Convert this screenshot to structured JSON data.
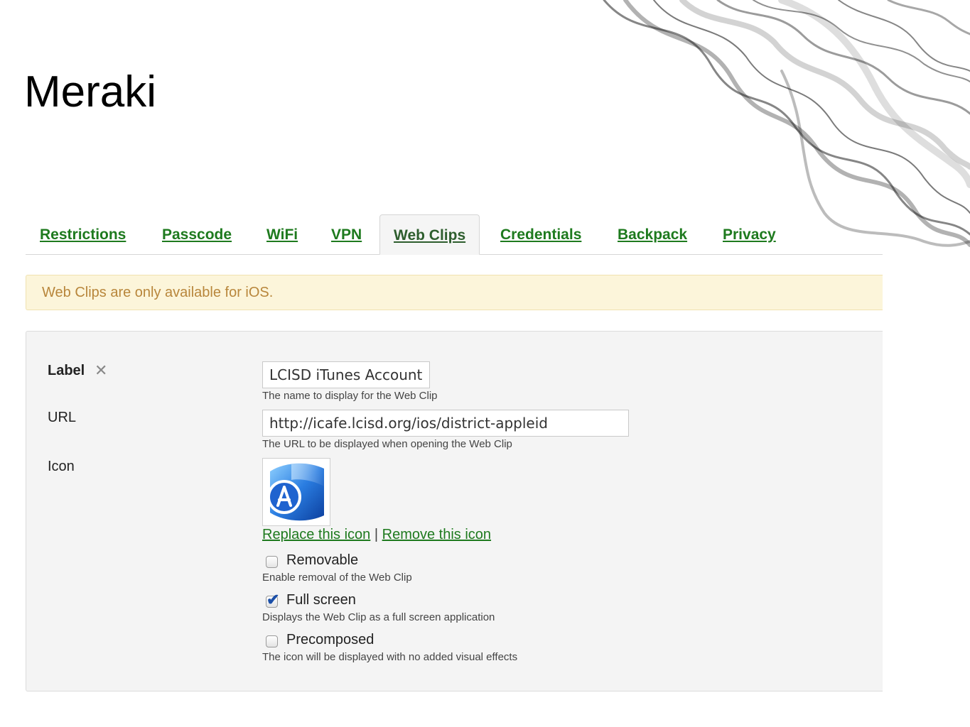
{
  "slide": {
    "title": "Meraki"
  },
  "tabs": [
    {
      "label": "Restrictions",
      "active": false
    },
    {
      "label": "Passcode",
      "active": false
    },
    {
      "label": "WiFi",
      "active": false
    },
    {
      "label": "VPN",
      "active": false
    },
    {
      "label": "Web Clips",
      "active": true
    },
    {
      "label": "Credentials",
      "active": false
    },
    {
      "label": "Backpack",
      "active": false
    },
    {
      "label": "Privacy",
      "active": false
    }
  ],
  "notice": {
    "text": "Web Clips are only available for iOS."
  },
  "form": {
    "label": {
      "title": "Label",
      "clear_icon": "close-icon",
      "value": "LCISD iTunes Account",
      "hint": "The name to display for the Web Clip"
    },
    "url": {
      "title": "URL",
      "value": "http://icafe.lcisd.org/ios/district-appleid",
      "hint": "The URL to be displayed when opening the Web Clip"
    },
    "icon": {
      "title": "Icon",
      "image": "app-store-icon",
      "replace_link": "Replace this icon",
      "separator": "|",
      "remove_link": "Remove this icon"
    },
    "options": [
      {
        "label": "Removable",
        "hint": "Enable removal of the Web Clip",
        "checked": false
      },
      {
        "label": "Full screen",
        "hint": "Displays the Web Clip as a full screen application",
        "checked": true
      },
      {
        "label": "Precomposed",
        "hint": "The icon will be displayed with no added visual effects",
        "checked": false
      }
    ]
  },
  "colors": {
    "link": "#1e7a1e",
    "notice_bg": "#fcf5da",
    "notice_text": "#b8863b",
    "panel_bg": "#f4f4f4"
  }
}
